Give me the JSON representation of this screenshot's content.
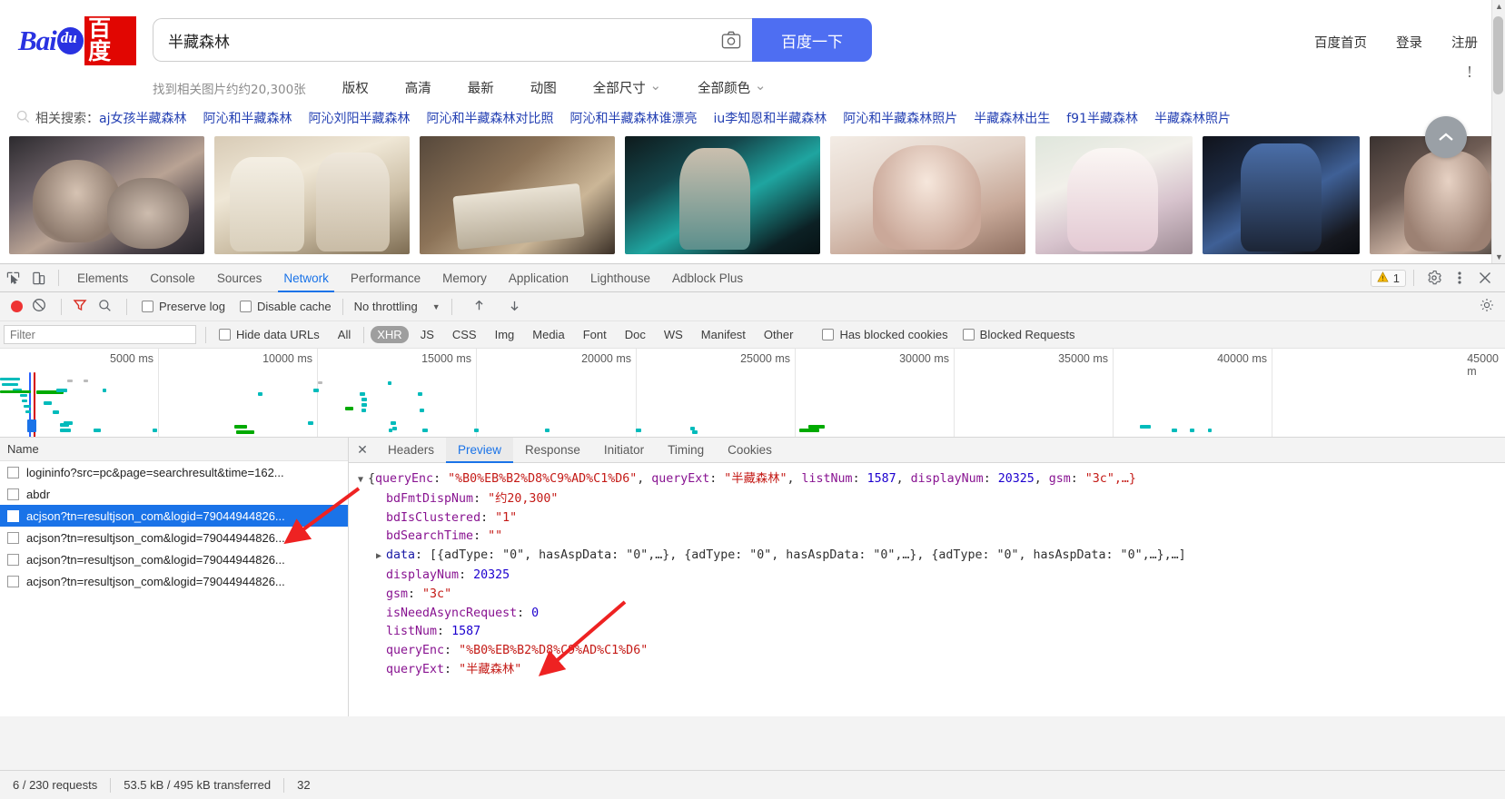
{
  "browser": {
    "logo": {
      "bai": "Bai",
      "du": "du",
      "cn": "百度"
    },
    "search": {
      "value": "半藏森林",
      "placeholder": "",
      "button_label": "百度一下",
      "camera_icon": "camera-icon"
    },
    "top_links": [
      "百度首页",
      "登录",
      "注册"
    ],
    "result_count": "找到相关图片约约20,300张",
    "filters": [
      {
        "label": "版权",
        "dropdown": false
      },
      {
        "label": "高清",
        "dropdown": false
      },
      {
        "label": "最新",
        "dropdown": false
      },
      {
        "label": "动图",
        "dropdown": false
      },
      {
        "label": "全部尺寸",
        "dropdown": true
      },
      {
        "label": "全部颜色",
        "dropdown": true
      }
    ],
    "related": {
      "label": "相关搜索：",
      "items": [
        "aj女孩半藏森林",
        "阿沁和半藏森林",
        "阿沁刘阳半藏森林",
        "阿沁和半藏森林对比照",
        "阿沁和半藏森林谁漂亮",
        "iu李知恩和半藏森林",
        "阿沁和半藏森林照片",
        "半藏森林出生",
        "f91半藏森林",
        "半藏森林照片"
      ]
    },
    "scroll_top_icon": "chevron-up-icon",
    "info_icon": "info-icon"
  },
  "devtools": {
    "tabs": [
      {
        "label": "Elements",
        "active": false
      },
      {
        "label": "Console",
        "active": false
      },
      {
        "label": "Sources",
        "active": false
      },
      {
        "label": "Network",
        "active": true
      },
      {
        "label": "Performance",
        "active": false
      },
      {
        "label": "Memory",
        "active": false
      },
      {
        "label": "Application",
        "active": false
      },
      {
        "label": "Lighthouse",
        "active": false
      },
      {
        "label": "Adblock Plus",
        "active": false
      }
    ],
    "tool_icons": [
      "inspect-element-icon",
      "device-toolbar-icon"
    ],
    "warning_count": "1",
    "right_icons": [
      "warning-icon",
      "settings-gear-icon",
      "more-vertical-icon",
      "close-icon"
    ],
    "toolbar": {
      "record_icon": "record-button",
      "clear_icon": "clear-icon",
      "filter_icon": "filter-funnel-icon",
      "search_icon": "search-icon",
      "preserve_log": "Preserve log",
      "disable_cache": "Disable cache",
      "throttling": "No throttling",
      "import_icon": "import-har-icon",
      "export_icon": "export-har-icon",
      "settings_icon": "settings-gear-icon"
    },
    "filterbar": {
      "filter_placeholder": "Filter",
      "filter_value": "",
      "hide_data_urls": "Hide data URLs",
      "types": [
        {
          "label": "All",
          "active": false
        },
        {
          "label": "XHR",
          "active": true
        },
        {
          "label": "JS",
          "active": false
        },
        {
          "label": "CSS",
          "active": false
        },
        {
          "label": "Img",
          "active": false
        },
        {
          "label": "Media",
          "active": false
        },
        {
          "label": "Font",
          "active": false
        },
        {
          "label": "Doc",
          "active": false
        },
        {
          "label": "WS",
          "active": false
        },
        {
          "label": "Manifest",
          "active": false
        },
        {
          "label": "Other",
          "active": false
        }
      ],
      "has_blocked_cookies": "Has blocked cookies",
      "blocked_requests": "Blocked Requests"
    },
    "overview": {
      "ticks": [
        "5000 ms",
        "10000 ms",
        "15000 ms",
        "20000 ms",
        "25000 ms",
        "30000 ms",
        "35000 ms",
        "40000 ms",
        "45000 m"
      ]
    },
    "request_list": {
      "column_header": "Name",
      "rows": [
        {
          "name": "logininfo?src=pc&page=searchresult&time=162...",
          "selected": false
        },
        {
          "name": "abdr",
          "selected": false
        },
        {
          "name": "acjson?tn=resultjson_com&logid=79044944826...",
          "selected": true
        },
        {
          "name": "acjson?tn=resultjson_com&logid=79044944826...",
          "selected": false
        },
        {
          "name": "acjson?tn=resultjson_com&logid=79044944826...",
          "selected": false
        },
        {
          "name": "acjson?tn=resultjson_com&logid=79044944826...",
          "selected": false
        }
      ]
    },
    "detail_tabs": [
      {
        "label": "Headers",
        "active": false
      },
      {
        "label": "Preview",
        "active": true
      },
      {
        "label": "Response",
        "active": false
      },
      {
        "label": "Initiator",
        "active": false
      },
      {
        "label": "Timing",
        "active": false
      },
      {
        "label": "Cookies",
        "active": false
      }
    ],
    "close_icon": "close-icon",
    "preview_json": {
      "root_line": {
        "open": "{",
        "entries": [
          {
            "key": "queryEnc",
            "value": "\"%B0%EB%B2%D8%C9%AD%C1%D6\"",
            "type": "string"
          },
          {
            "key": "queryExt",
            "value": "\"半藏森林\"",
            "type": "string"
          },
          {
            "key": "listNum",
            "value": "1587",
            "type": "number"
          },
          {
            "key": "displayNum",
            "value": "20325",
            "type": "number"
          },
          {
            "key": "gsm",
            "value": "\"3c\",…}",
            "type": "string"
          }
        ]
      },
      "lines": [
        {
          "indent": 1,
          "triangle": false,
          "key": "bdFmtDispNum",
          "value": "\"约20,300\"",
          "type": "string"
        },
        {
          "indent": 1,
          "triangle": false,
          "key": "bdIsClustered",
          "value": "\"1\"",
          "type": "string"
        },
        {
          "indent": 1,
          "triangle": false,
          "key": "bdSearchTime",
          "value": "\"\"",
          "type": "string"
        },
        {
          "indent": 1,
          "triangle": true,
          "key": "data",
          "value": "[{adType: \"0\", hasAspData: \"0\",…}, {adType: \"0\", hasAspData: \"0\",…}, {adType: \"0\", hasAspData: \"0\",…},…]",
          "type": "object"
        },
        {
          "indent": 1,
          "triangle": false,
          "key": "displayNum",
          "value": "20325",
          "type": "number"
        },
        {
          "indent": 1,
          "triangle": false,
          "key": "gsm",
          "value": "\"3c\"",
          "type": "string"
        },
        {
          "indent": 1,
          "triangle": false,
          "key": "isNeedAsyncRequest",
          "value": "0",
          "type": "number"
        },
        {
          "indent": 1,
          "triangle": false,
          "key": "listNum",
          "value": "1587",
          "type": "number"
        },
        {
          "indent": 1,
          "triangle": false,
          "key": "queryEnc",
          "value": "\"%B0%EB%B2%D8%C9%AD%C1%D6\"",
          "type": "string"
        },
        {
          "indent": 1,
          "triangle": false,
          "key": "queryExt",
          "value": "\"半藏森林\"",
          "type": "string"
        }
      ]
    },
    "status_bar": {
      "requests": "6 / 230 requests",
      "transferred": "53.5 kB / 495 kB transferred",
      "extra": "32"
    }
  },
  "colors": {
    "accent_blue": "#1a73e8",
    "baidu_blue": "#4e6ef2",
    "link_blue": "#2440b3",
    "json_string": "#c41a16",
    "json_key": "#881391",
    "json_number": "#1c00cf",
    "annotation_red": "#ee2222"
  }
}
